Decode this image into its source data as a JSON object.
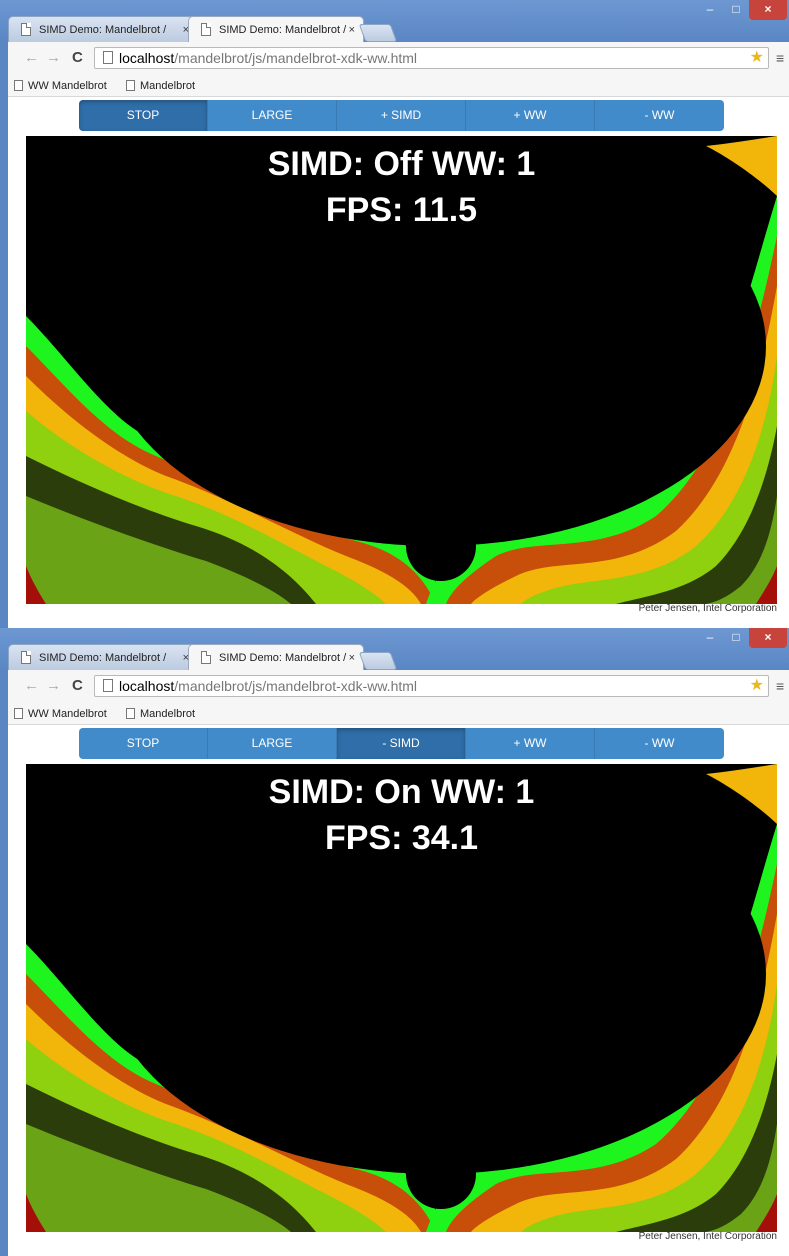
{
  "windows": [
    {
      "tabs": [
        {
          "label": "SIMD Demo: Mandelbrot /",
          "close": "×"
        },
        {
          "label": "SIMD Demo: Mandelbrot /",
          "close": "×"
        }
      ],
      "active_tab": 1,
      "window_controls": {
        "minimize": "–",
        "maximize": "□",
        "close": "×"
      },
      "address": {
        "host": "localhost",
        "path": "/mandelbrot/js/mandelbrot-xdk-ww.html"
      },
      "bookmarks": [
        "WW Mandelbrot",
        "Mandelbrot"
      ],
      "controls": [
        {
          "label": "STOP",
          "pressed": true
        },
        {
          "label": "LARGE",
          "pressed": false
        },
        {
          "label": "+ SIMD",
          "pressed": false
        },
        {
          "label": "+ WW",
          "pressed": false
        },
        {
          "label": "- WW",
          "pressed": false
        }
      ],
      "overlay": {
        "line1": "SIMD: Off WW: 1",
        "line2": "FPS: 11.5"
      },
      "credit": "Peter Jensen, Intel Corporation"
    },
    {
      "tabs": [
        {
          "label": "SIMD Demo: Mandelbrot /",
          "close": "×"
        },
        {
          "label": "SIMD Demo: Mandelbrot /",
          "close": "×"
        }
      ],
      "active_tab": 1,
      "window_controls": {
        "minimize": "–",
        "maximize": "□",
        "close": "×"
      },
      "address": {
        "host": "localhost",
        "path": "/mandelbrot/js/mandelbrot-xdk-ww.html"
      },
      "bookmarks": [
        "WW Mandelbrot",
        "Mandelbrot"
      ],
      "controls": [
        {
          "label": "STOP",
          "pressed": false
        },
        {
          "label": "LARGE",
          "pressed": false
        },
        {
          "label": "- SIMD",
          "pressed": true
        },
        {
          "label": "+ WW",
          "pressed": false
        },
        {
          "label": "- WW",
          "pressed": false
        }
      ],
      "overlay": {
        "line1": "SIMD: On WW: 1",
        "line2": "FPS: 34.1"
      },
      "credit": "Peter Jensen, Intel Corporation"
    }
  ],
  "icons": {
    "back": "back-arrow-icon",
    "forward": "forward-arrow-icon",
    "reload": "reload-icon",
    "page": "page-icon",
    "bookmark_star": "star-icon",
    "menu": "menu-icon"
  },
  "colors": {
    "button": "#428bca",
    "button_pressed": "#2f6ea8",
    "title_bar": "#5a86c4",
    "fractal_bands": [
      "#2b3d0a",
      "#6aa315",
      "#f2b50a",
      "#c84f0a",
      "#8fd10f",
      "#1ef51e",
      "#a50f0a"
    ]
  }
}
